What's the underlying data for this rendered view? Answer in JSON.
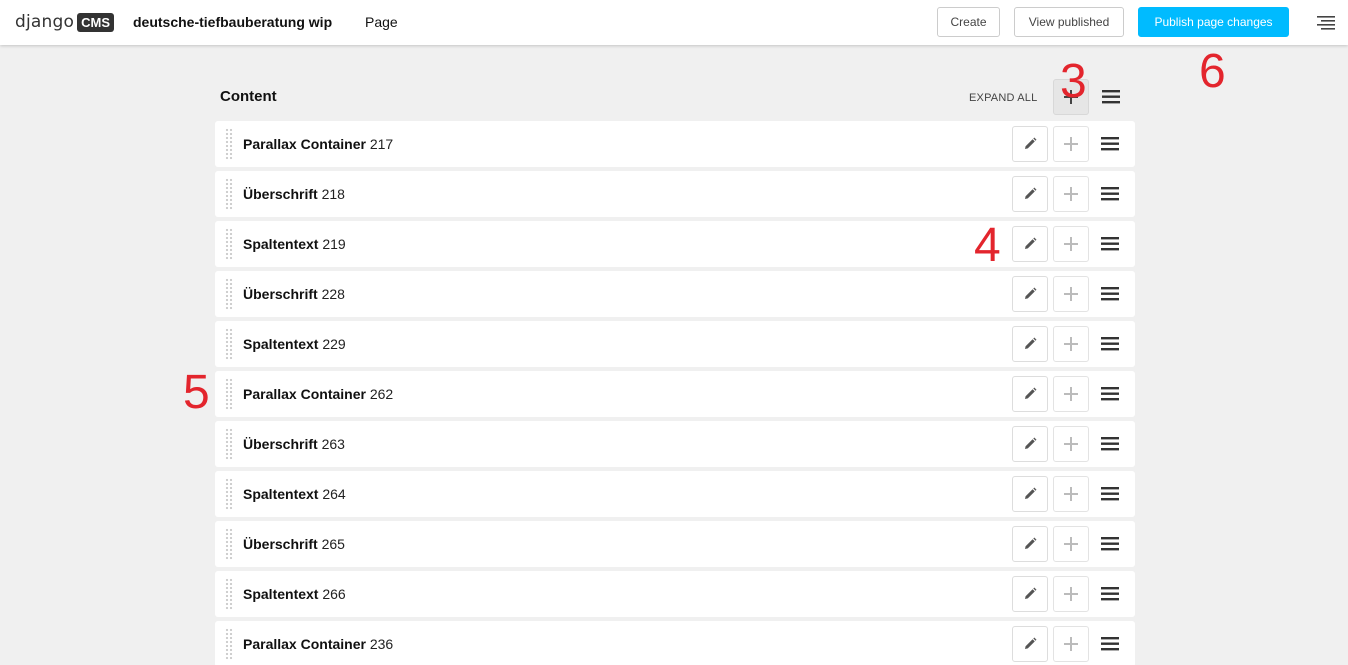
{
  "toolbar": {
    "logo_text": "django",
    "logo_badge": "CMS",
    "site_name": "deutsche-tiefbauberatung wip",
    "page_menu": "Page",
    "create_label": "Create",
    "view_published_label": "View published",
    "publish_label": "Publish page changes",
    "publish_color": "#00bbff"
  },
  "structure": {
    "title": "Content",
    "expand_all": "EXPAND ALL"
  },
  "plugins": [
    {
      "name": "Parallax Container",
      "id": "217"
    },
    {
      "name": "Überschrift",
      "id": "218"
    },
    {
      "name": "Spaltentext",
      "id": "219"
    },
    {
      "name": "Überschrift",
      "id": "228"
    },
    {
      "name": "Spaltentext",
      "id": "229"
    },
    {
      "name": "Parallax Container",
      "id": "262"
    },
    {
      "name": "Überschrift",
      "id": "263"
    },
    {
      "name": "Spaltentext",
      "id": "264"
    },
    {
      "name": "Überschrift",
      "id": "265"
    },
    {
      "name": "Spaltentext",
      "id": "266"
    },
    {
      "name": "Parallax Container",
      "id": "236"
    }
  ],
  "annotations": {
    "a3": "3",
    "a4": "4",
    "a5": "5",
    "a6": "6"
  }
}
